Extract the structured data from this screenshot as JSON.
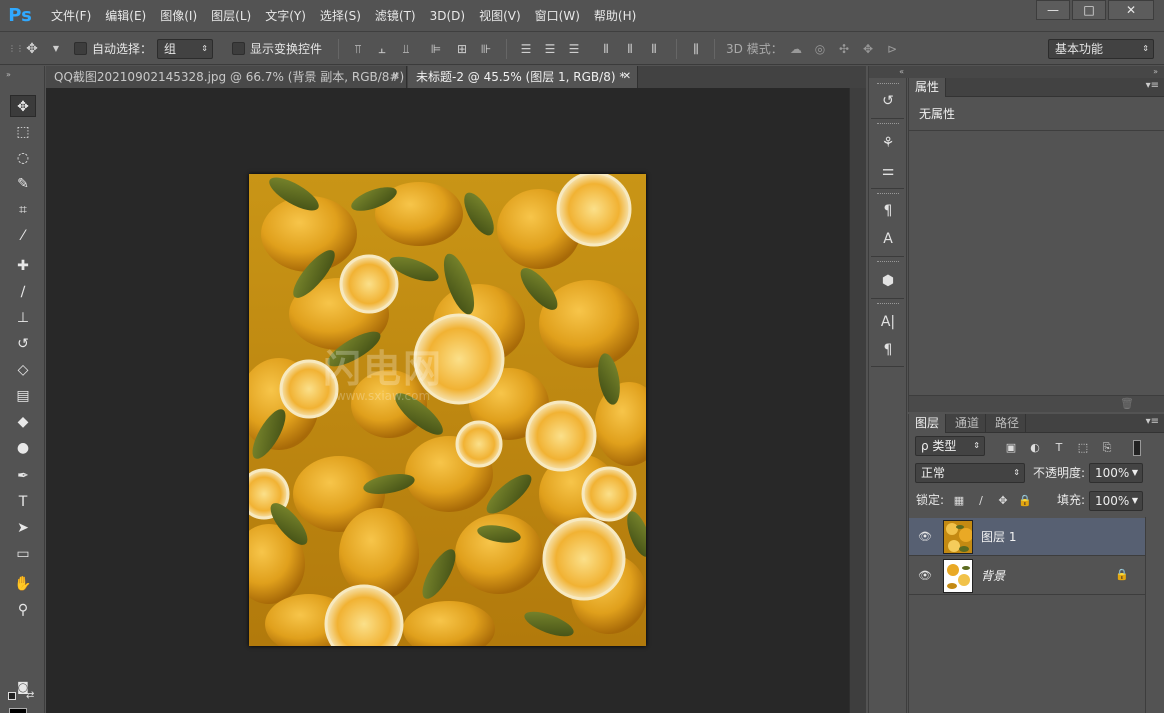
{
  "app": {
    "logo": "Ps"
  },
  "menu": [
    "文件(F)",
    "编辑(E)",
    "图像(I)",
    "图层(L)",
    "文字(Y)",
    "选择(S)",
    "滤镜(T)",
    "3D(D)",
    "视图(V)",
    "窗口(W)",
    "帮助(H)"
  ],
  "window_controls": {
    "minimize": "—",
    "maximize": "□",
    "close": "✕"
  },
  "options": {
    "auto_select_label": "自动选择：",
    "auto_select_value": "组",
    "show_transform_label": "显示变换控件",
    "mode_3d_label": "3D 模式：",
    "workspace": "基本功能"
  },
  "doc_tabs": [
    {
      "title": "QQ截图20210902145328.jpg @ 66.7% (背景 副本, RGB/8#) *",
      "active": false
    },
    {
      "title": "未标题-2 @ 45.5% (图层 1, RGB/8) *",
      "active": true
    }
  ],
  "tab_close": "✕",
  "watermark": {
    "big": "闪电网",
    "small": "www.sxiaw.com"
  },
  "properties": {
    "tab": "属性",
    "empty": "无属性"
  },
  "layers_panel": {
    "tabs": [
      "图层",
      "通道",
      "路径"
    ],
    "filter_label": "ρ 类型",
    "blend_mode": "正常",
    "opacity_label": "不透明度:",
    "opacity_value": "100%",
    "lock_label": "锁定:",
    "fill_label": "填充:",
    "fill_value": "100%",
    "layers": [
      {
        "name": "图层 1",
        "selected": true,
        "locked": false
      },
      {
        "name": "背景",
        "selected": false,
        "locked": true
      }
    ]
  },
  "colors": {
    "foreground": "#000000",
    "background": "#ffffff",
    "accent": "#30a9ff",
    "selection": "#576072"
  }
}
